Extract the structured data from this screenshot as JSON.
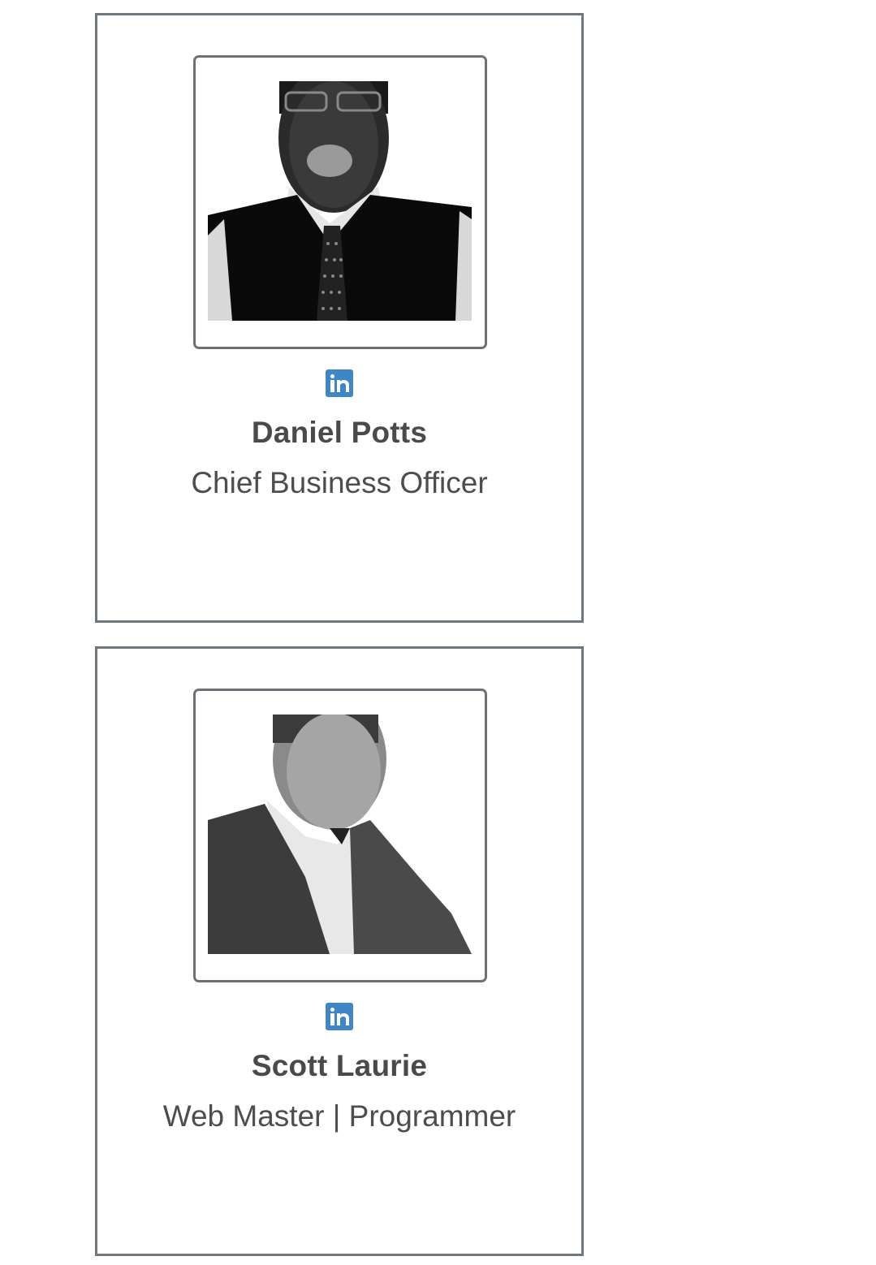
{
  "team": {
    "members": [
      {
        "name": "Daniel Potts",
        "role": "Chief Business Officer",
        "social_icon": "linkedin-icon",
        "photo": "grayscale-portrait"
      },
      {
        "name": "Scott Laurie",
        "role": "Web Master | Programmer",
        "social_icon": "linkedin-icon",
        "photo": "grayscale-portrait"
      }
    ]
  },
  "colors": {
    "card_border": "#6f777d",
    "linkedin": "#3e86c6",
    "text": "#4a4a4a"
  }
}
